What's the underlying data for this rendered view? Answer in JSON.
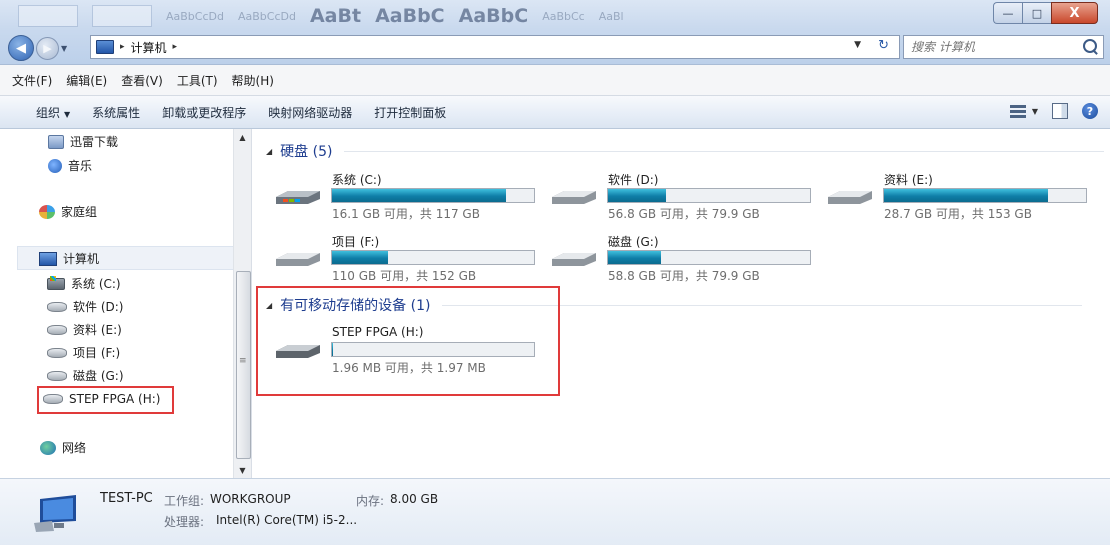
{
  "window": {
    "ribbon_samples": [
      "AaBbCcDd",
      "AaBbCcDd",
      "AaBt",
      "AaBbC",
      "AaBbC",
      "AaBbCc",
      "AaBl"
    ],
    "caption_buttons": {
      "minimize": "—",
      "maximize": "□",
      "close": "X"
    }
  },
  "address": {
    "location": "计算机",
    "separator": "▸"
  },
  "search": {
    "placeholder": "搜索 计算机"
  },
  "menu": [
    "文件(F)",
    "编辑(E)",
    "查看(V)",
    "工具(T)",
    "帮助(H)"
  ],
  "commands": {
    "organize": "组织",
    "system_props": "系统属性",
    "uninstall": "卸载或更改程序",
    "map_drive": "映射网络驱动器",
    "control_panel": "打开控制面板"
  },
  "sidebar": {
    "items": [
      {
        "label": "迅雷下载",
        "icon": "download-icon"
      },
      {
        "label": "音乐",
        "icon": "music-icon"
      },
      {
        "label": "家庭组",
        "icon": "homegroup-icon"
      },
      {
        "label": "计算机",
        "icon": "computer-icon"
      },
      {
        "label": "系统 (C:)",
        "icon": "system-drive-icon"
      },
      {
        "label": "软件 (D:)",
        "icon": "drive-icon"
      },
      {
        "label": "资料 (E:)",
        "icon": "drive-icon"
      },
      {
        "label": "项目 (F:)",
        "icon": "drive-icon"
      },
      {
        "label": "磁盘 (G:)",
        "icon": "drive-icon"
      },
      {
        "label": "STEP FPGA (H:)",
        "icon": "usb-drive-icon"
      },
      {
        "label": "网络",
        "icon": "network-icon"
      }
    ]
  },
  "groups": {
    "hard_disks": {
      "title": "硬盘 (5)"
    },
    "removable": {
      "title": "有可移动存储的设备 (1)"
    }
  },
  "drives": [
    {
      "name": "系统 (C:)",
      "info": "16.1 GB 可用，共 117 GB",
      "used_fraction": 0.862,
      "type": "system"
    },
    {
      "name": "软件 (D:)",
      "info": "56.8 GB 可用，共 79.9 GB",
      "used_fraction": 0.289,
      "type": "disk"
    },
    {
      "name": "资料 (E:)",
      "info": "28.7 GB 可用，共 153 GB",
      "used_fraction": 0.812,
      "type": "disk"
    },
    {
      "name": "项目 (F:)",
      "info": "110 GB 可用，共 152 GB",
      "used_fraction": 0.276,
      "type": "disk"
    },
    {
      "name": "磁盘 (G:)",
      "info": "58.8 GB 可用，共 79.9 GB",
      "used_fraction": 0.264,
      "type": "disk"
    },
    {
      "name": "STEP FPGA (H:)",
      "info": "1.96 MB 可用，共 1.97 MB",
      "used_fraction": 0.005,
      "type": "usb"
    }
  ],
  "details": {
    "computer_name": "TEST-PC",
    "workgroup_label": "工作组:",
    "workgroup": "WORKGROUP",
    "memory_label": "内存:",
    "memory": "8.00 GB",
    "processor_label": "处理器:",
    "processor": "Intel(R) Core(TM) i5-2..."
  },
  "colors": {
    "highlight": "#e03a3a",
    "bar_fill": "#1689b4",
    "group_title": "#1e3d8f"
  }
}
